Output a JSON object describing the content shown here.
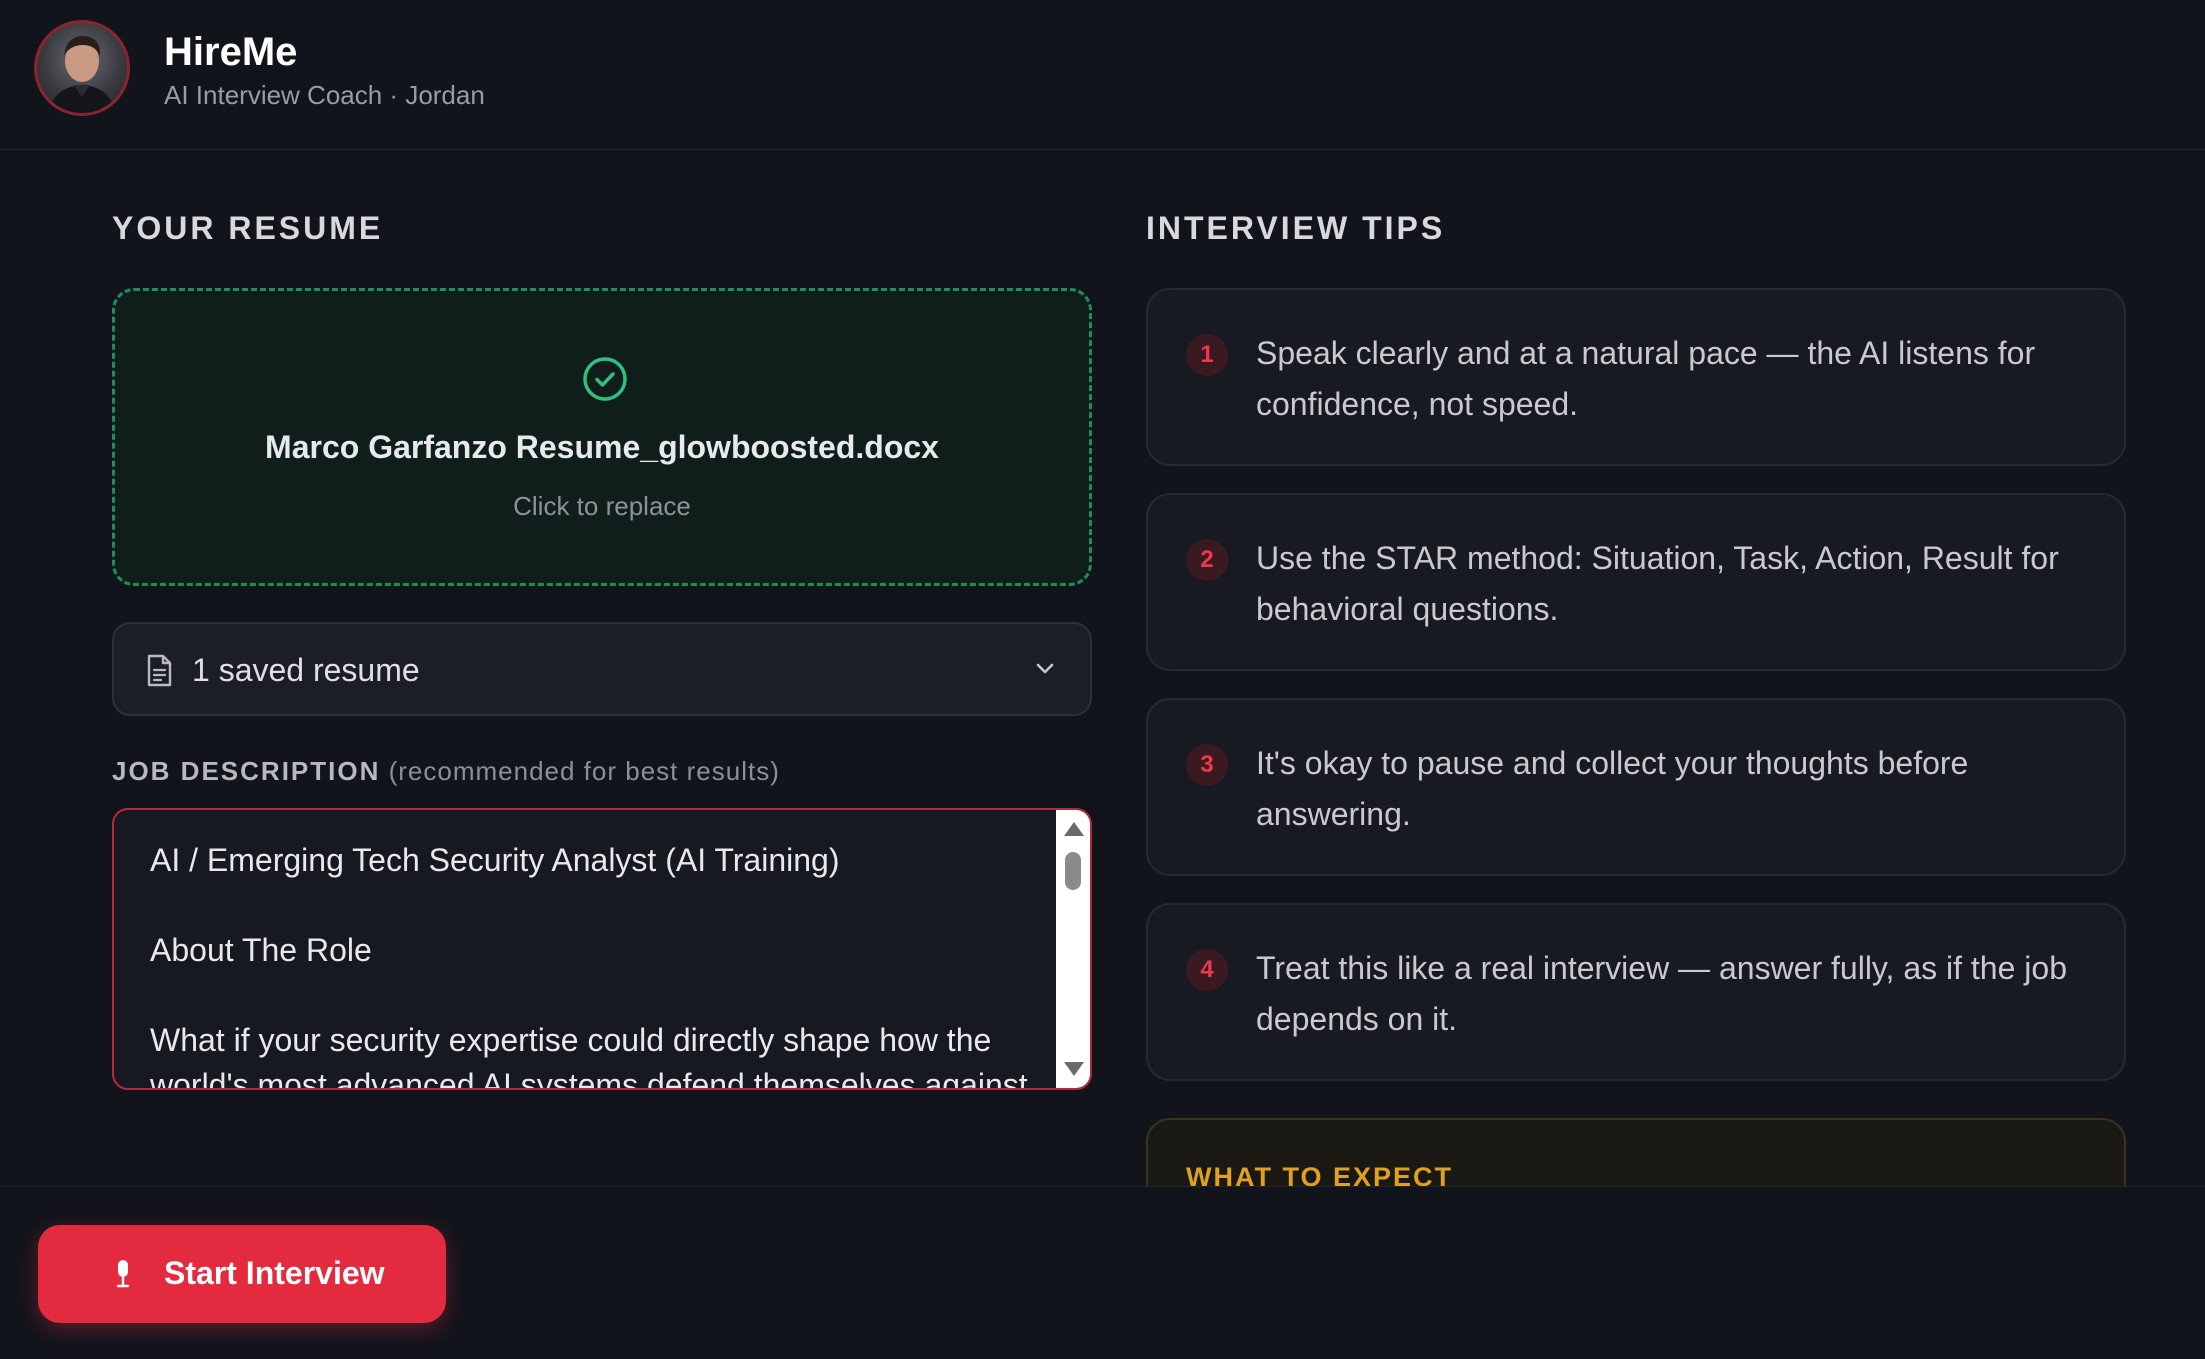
{
  "header": {
    "title": "HireMe",
    "subtitle": "AI Interview Coach · Jordan"
  },
  "resume": {
    "section_title": "YOUR RESUME",
    "file_name": "Marco Garfanzo Resume_glowboosted.docx",
    "replace_hint": "Click to replace",
    "saved_select": "1 saved resume"
  },
  "job_description": {
    "label": "JOB DESCRIPTION",
    "label_hint": "(recommended for best results)",
    "lines": [
      "AI / Emerging Tech Security Analyst (AI Training)",
      "About The Role",
      "What if your security expertise could directly shape how the world's most advanced AI systems defend themselves against"
    ]
  },
  "tips": {
    "section_title": "INTERVIEW TIPS",
    "items": [
      {
        "num": "1",
        "text": "Speak clearly and at a natural pace — the AI listens for confidence, not speed."
      },
      {
        "num": "2",
        "text": "Use the STAR method: Situation, Task, Action, Result for behavioral questions."
      },
      {
        "num": "3",
        "text": "It's okay to pause and collect your thoughts before answering."
      },
      {
        "num": "4",
        "text": "Treat this like a real interview — answer fully, as if the job depends on it."
      }
    ],
    "expect_title": "WHAT TO EXPECT"
  },
  "footer": {
    "start_button": "Start Interview"
  },
  "colors": {
    "accent": "#e32a3f",
    "success": "#1f8c5c",
    "warning": "#e0a020",
    "background": "#12141b"
  },
  "icons": [
    "avatar",
    "check-circle-icon",
    "document-icon",
    "chevron-down-icon",
    "microphone-icon"
  ]
}
